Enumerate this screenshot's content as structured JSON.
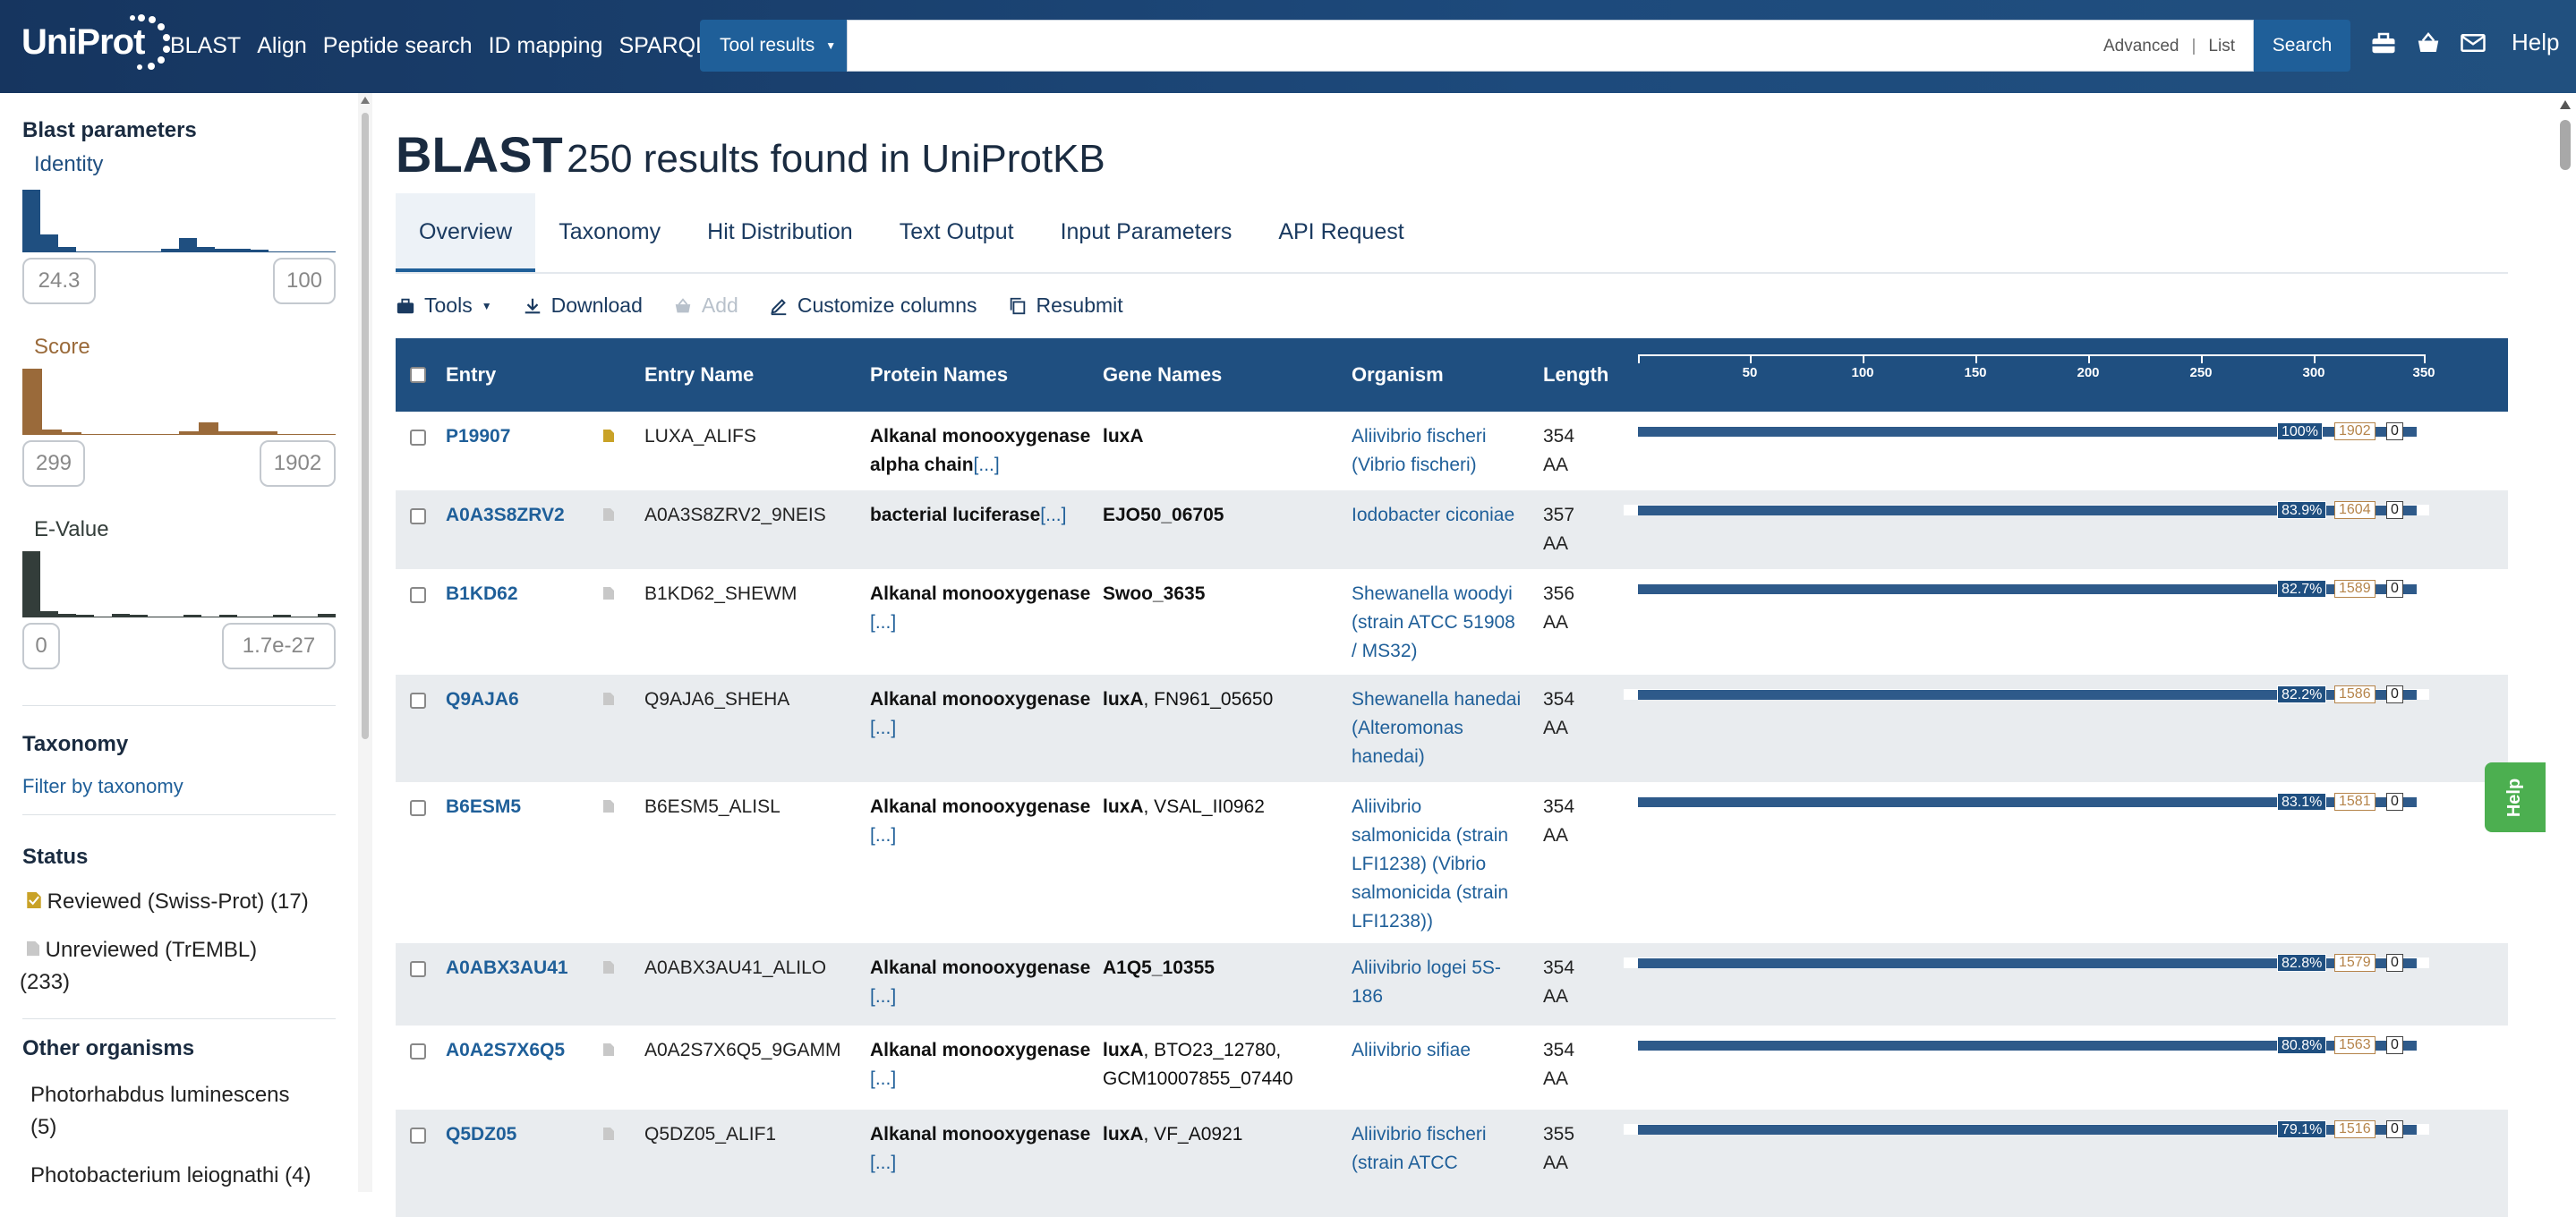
{
  "header": {
    "logo": "UniProt",
    "nav": [
      "BLAST",
      "Align",
      "Peptide search",
      "ID mapping",
      "SPARQL"
    ],
    "tool_dropdown": "Tool results",
    "search_value": "",
    "advanced": "Advanced",
    "list": "List",
    "search_button": "Search",
    "help": "Help"
  },
  "sidebar": {
    "title": "Blast parameters",
    "identity": {
      "label": "Identity",
      "min": "24.3",
      "max": "100"
    },
    "score": {
      "label": "Score",
      "min": "299",
      "max": "1902"
    },
    "evalue": {
      "label": "E-Value",
      "min": "0",
      "max": "1.7e-27"
    },
    "taxonomy": {
      "label": "Taxonomy",
      "link": "Filter by taxonomy"
    },
    "status": {
      "label": "Status",
      "reviewed": "Reviewed (Swiss-Prot) (17)",
      "unreviewed_1": "Unreviewed (TrEMBL)",
      "unreviewed_2": "(233)"
    },
    "other_organisms": {
      "label": "Other organisms",
      "items": [
        "Photorhabdus luminescens",
        "(5)",
        "Photobacterium leiognathi (4)"
      ]
    }
  },
  "main": {
    "title_big": "BLAST",
    "title_small": "250 results found in UniProtKB",
    "tabs": [
      "Overview",
      "Taxonomy",
      "Hit Distribution",
      "Text Output",
      "Input Parameters",
      "API Request"
    ],
    "actions": {
      "tools": "Tools",
      "download": "Download",
      "add": "Add",
      "customize": "Customize columns",
      "resubmit": "Resubmit"
    },
    "columns": [
      "Entry",
      "Entry Name",
      "Protein Names",
      "Gene Names",
      "Organism",
      "Length"
    ],
    "ticks": [
      "50",
      "100",
      "150",
      "200",
      "250",
      "300",
      "350"
    ],
    "rows": [
      {
        "entry": "P19907",
        "name": "LUXA_ALIFS",
        "protein": [
          "Alkanal monooxygenase",
          "alpha chain"
        ],
        "more": "[...]",
        "gene_bold": "luxA",
        "gene_rest": "",
        "gene2": "",
        "organism": [
          "Aliivibrio fischeri",
          "(Vibrio fischeri)"
        ],
        "length": [
          "354",
          "AA"
        ],
        "identity": "100%",
        "score": "1902",
        "evalue": "0"
      },
      {
        "entry": "A0A3S8ZRV2",
        "name": "A0A3S8ZRV2_9NEIS",
        "protein": [
          "bacterial luciferase"
        ],
        "more": "[...]",
        "gene_bold": "EJO50_06705",
        "gene_rest": "",
        "gene2": "",
        "organism": [
          "Iodobacter ciconiae"
        ],
        "length": [
          "357",
          "AA"
        ],
        "identity": "83.9%",
        "score": "1604",
        "evalue": "0"
      },
      {
        "entry": "B1KD62",
        "name": "B1KD62_SHEWM",
        "protein": [
          "Alkanal monooxygenase"
        ],
        "more": "[...]",
        "gene_bold": "Swoo_3635",
        "gene_rest": "",
        "gene2": "",
        "organism": [
          "Shewanella woodyi",
          "(strain ATCC 51908",
          "/ MS32)"
        ],
        "length": [
          "356",
          "AA"
        ],
        "identity": "82.7%",
        "score": "1589",
        "evalue": "0"
      },
      {
        "entry": "Q9AJA6",
        "name": "Q9AJA6_SHEHA",
        "protein": [
          "Alkanal monooxygenase"
        ],
        "more": "[...]",
        "gene_bold": "luxA",
        "gene_rest": ", FN961_05650",
        "gene2": "",
        "organism": [
          "Shewanella hanedai",
          "(Alteromonas",
          "hanedai)"
        ],
        "length": [
          "354",
          "AA"
        ],
        "identity": "82.2%",
        "score": "1586",
        "evalue": "0"
      },
      {
        "entry": "B6ESM5",
        "name": "B6ESM5_ALISL",
        "protein": [
          "Alkanal monooxygenase"
        ],
        "more": "[...]",
        "gene_bold": "luxA",
        "gene_rest": ", VSAL_II0962",
        "gene2": "",
        "organism": [
          "Aliivibrio",
          "salmonicida (strain",
          "LFI1238) (Vibrio",
          "salmonicida (strain",
          "LFI1238))"
        ],
        "length": [
          "354",
          "AA"
        ],
        "identity": "83.1%",
        "score": "1581",
        "evalue": "0"
      },
      {
        "entry": "A0ABX3AU41",
        "name": "A0ABX3AU41_ALILO",
        "protein": [
          "Alkanal monooxygenase"
        ],
        "more": "[...]",
        "gene_bold": "A1Q5_10355",
        "gene_rest": "",
        "gene2": "",
        "organism": [
          "Aliivibrio logei 5S-",
          "186"
        ],
        "length": [
          "354",
          "AA"
        ],
        "identity": "82.8%",
        "score": "1579",
        "evalue": "0"
      },
      {
        "entry": "A0A2S7X6Q5",
        "name": "A0A2S7X6Q5_9GAMM",
        "protein": [
          "Alkanal monooxygenase"
        ],
        "more": "[...]",
        "gene_bold": "luxA",
        "gene_rest": ", BTO23_12780,",
        "gene2": "GCM10007855_07440",
        "organism": [
          "Aliivibrio sifiae"
        ],
        "length": [
          "354",
          "AA"
        ],
        "identity": "80.8%",
        "score": "1563",
        "evalue": "0"
      },
      {
        "entry": "Q5DZ05",
        "name": "Q5DZ05_ALIF1",
        "protein": [
          "Alkanal monooxygenase"
        ],
        "more": "[...]",
        "gene_bold": "luxA",
        "gene_rest": ", VF_A0921",
        "gene2": "",
        "organism": [
          "Aliivibrio fischeri",
          "(strain ATCC"
        ],
        "length": [
          "355",
          "AA"
        ],
        "identity": "79.1%",
        "score": "1516",
        "evalue": "0"
      }
    ]
  },
  "help_tab": "Help",
  "colors": {
    "header": "#1d4a7c",
    "accent": "#1f5f99",
    "identity": "#1f4f80",
    "score": "#9a6a3a",
    "evalue": "#333d3a"
  }
}
